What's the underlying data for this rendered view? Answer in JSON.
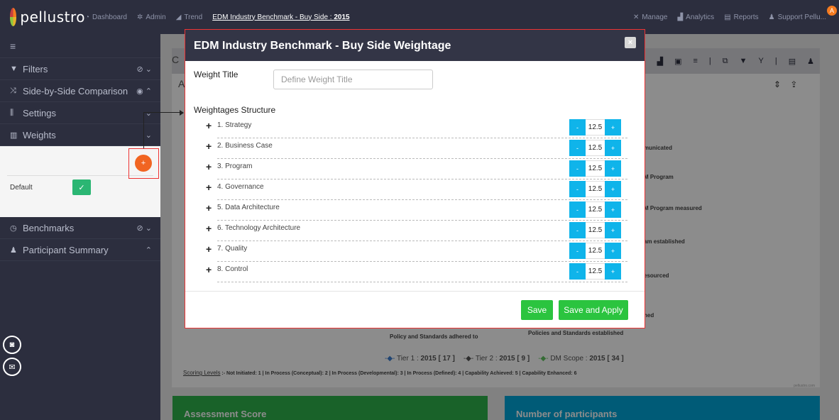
{
  "navbar": {
    "logo_text": "pellustro",
    "items": [
      "Dashboard",
      "Admin",
      "Trend"
    ],
    "breadcrumb_prefix": "EDM Industry Benchmark - Buy Side : ",
    "breadcrumb_year": "2015",
    "right_items": [
      "Manage",
      "Analytics",
      "Reports",
      "Support Pellu..."
    ],
    "avatar_badge": "A"
  },
  "sidebar": {
    "menu_icon": "≡",
    "rows": [
      {
        "label": "Filters",
        "icon": "funnel-icon"
      },
      {
        "label": "Side-by-Side Comparison",
        "icon": "shuffle-icon"
      },
      {
        "label": "Settings",
        "icon": "sliders-icon"
      },
      {
        "label": "Weights",
        "icon": "scale-icon"
      }
    ],
    "weights_panel": {
      "default_label": "Default"
    },
    "rows_after": [
      {
        "label": "Benchmarks",
        "icon": "gauge-icon"
      },
      {
        "label": "Participant Summary",
        "icon": "users-icon"
      }
    ]
  },
  "background": {
    "header_letter": "C",
    "section_letter": "A",
    "chart_labels": [
      "municated",
      "M Program",
      "M Program measured",
      "am established",
      "esourced",
      "hed"
    ],
    "category_left": "Policy and Standards adhered to",
    "category_right": "Policies and Standards established",
    "legend": [
      {
        "name": "Tier 1 : ",
        "value": "2015 [ 17 ]"
      },
      {
        "name": "Tier 2 : ",
        "value": "2015 [ 9 ]"
      },
      {
        "name": "DM Scope : ",
        "value": "2015 [ 34 ]"
      }
    ],
    "scoring_title": "Scoring Levels",
    "scoring_text": " :- Not Initiated: 1 | In Process (Conceptual): 2 | In Process (Developmental): 3 | In Process (Defined): 4 | Capability Achieved: 5 | Capability Enhanced: 6",
    "watermark": "pellustro.com",
    "card_left": "Assessment Score",
    "card_right": "Number of participants"
  },
  "modal": {
    "title": "EDM Industry Benchmark - Buy Side Weightage",
    "close_label": "×",
    "weight_title_label": "Weight Title",
    "weight_title_placeholder": "Define Weight Title",
    "weight_title_value": "",
    "structure_label": "Weightages Structure",
    "items": [
      {
        "name": "1. Strategy",
        "value": "12.5"
      },
      {
        "name": "2. Business Case",
        "value": "12.5"
      },
      {
        "name": "3. Program",
        "value": "12.5"
      },
      {
        "name": "4. Governance",
        "value": "12.5"
      },
      {
        "name": "5. Data Architecture",
        "value": "12.5"
      },
      {
        "name": "6. Technology Architecture",
        "value": "12.5"
      },
      {
        "name": "7. Quality",
        "value": "12.5"
      },
      {
        "name": "8. Control",
        "value": "12.5"
      }
    ],
    "minus_label": "-",
    "plus_label": "+",
    "save_label": "Save",
    "save_apply_label": "Save and Apply"
  }
}
